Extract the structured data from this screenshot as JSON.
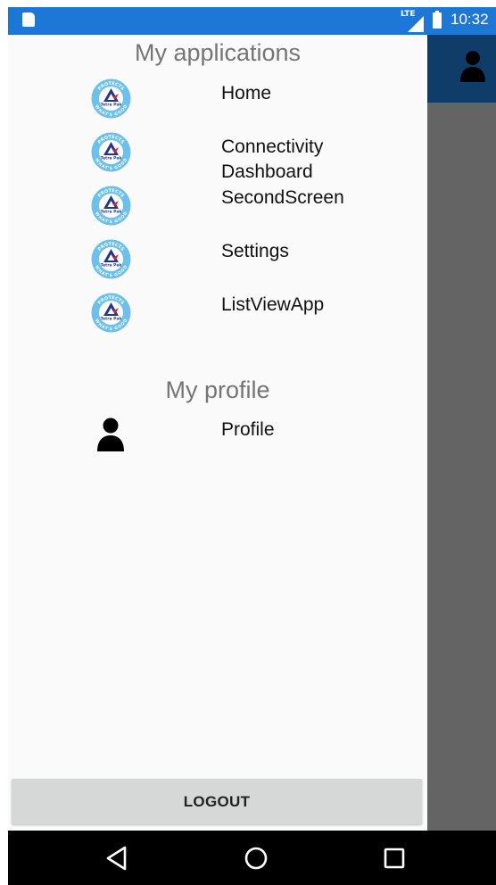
{
  "status_bar": {
    "network": "LTE",
    "time": "10:32"
  },
  "drawer": {
    "applications_title": "My applications",
    "applications": [
      {
        "label": "Home",
        "icon": "tetra-pak-logo-icon"
      },
      {
        "label": "Connectivity\nDashboard",
        "icon": "tetra-pak-logo-icon"
      },
      {
        "label": "SecondScreen",
        "icon": "tetra-pak-logo-icon"
      },
      {
        "label": "Settings",
        "icon": "tetra-pak-logo-icon"
      },
      {
        "label": "ListViewApp",
        "icon": "tetra-pak-logo-icon"
      }
    ],
    "profile_title": "My profile",
    "profile": {
      "label": "Profile",
      "icon": "person-icon"
    },
    "logout_label": "LOGOUT"
  },
  "logo_text": {
    "ring_top": "PROTECTS",
    "ring_bottom": "WHAT'S GOOD",
    "brand": "Tetra Pak"
  },
  "colors": {
    "status_bar": "#1d77d6",
    "toolbar": "#0f3c68",
    "logo_ring": "#6cc0ea",
    "logo_mark": "#23368a"
  }
}
